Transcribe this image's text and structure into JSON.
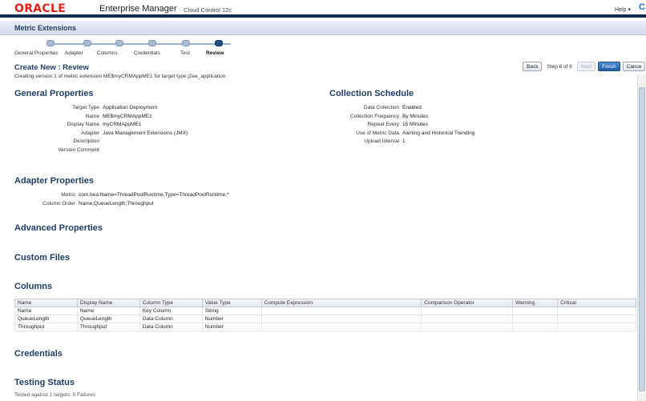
{
  "header": {
    "brand": "ORACLE",
    "product": "Enterprise Manager",
    "subtitle": "Cloud Control 12c",
    "help": "Help ▾",
    "right_icon": "C"
  },
  "band": {
    "title": "Metric Extensions"
  },
  "train": [
    {
      "label": "General Properties",
      "active": false
    },
    {
      "label": "Adapter",
      "active": false
    },
    {
      "label": "Columns",
      "active": false
    },
    {
      "label": "Credentials",
      "active": false
    },
    {
      "label": "Test",
      "active": false
    },
    {
      "label": "Review",
      "active": true
    }
  ],
  "page": {
    "title": "Create New : Review",
    "description": "Creating version 1 of metric extension ME$myCRMAppME1 for target type j2ee_application"
  },
  "nav": {
    "back": "Back",
    "step": "Step 6 of 6",
    "next": "Next",
    "finish": "Finish",
    "cancel": "Cance"
  },
  "general": {
    "heading": "General Properties",
    "rows": [
      {
        "label": "Target Type",
        "value": "Application Deployment"
      },
      {
        "label": "Name",
        "value": "ME$myCRMAppME1"
      },
      {
        "label": "Display Name",
        "value": "myCRMAppME1"
      },
      {
        "label": "Adapter",
        "value": "Java Management Extensions (JMX)"
      },
      {
        "label": "Description",
        "value": ""
      },
      {
        "label": "Version Comment",
        "value": ""
      }
    ]
  },
  "schedule": {
    "heading": "Collection Schedule",
    "rows": [
      {
        "label": "Data Collection",
        "value": "Enabled"
      },
      {
        "label": "Collection Frequency",
        "value": "By Minutes"
      },
      {
        "label": "Repeat Every",
        "value": "15      Minutes"
      },
      {
        "label": "Use of Metric Data",
        "value": "Alerting and Historical Trending"
      },
      {
        "label": "Upload Interval",
        "value": "1"
      }
    ]
  },
  "adapter": {
    "heading": "Adapter Properties",
    "rows": [
      {
        "label": "Metric",
        "value": "com.bea:Name=ThreadPoolRuntime,Type=ThreadPoolRuntime,*"
      },
      {
        "label": "Column Order",
        "value": "Name;QueueLength;Throughput"
      }
    ]
  },
  "advanced": {
    "heading": "Advanced Properties"
  },
  "custom_files": {
    "heading": "Custom Files"
  },
  "columns": {
    "heading": "Columns",
    "headers": [
      "Name",
      "Display Name",
      "Column Type",
      "Value Type",
      "Compute Expression",
      "Comparison Operator",
      "Warning",
      "Critical"
    ],
    "rows": [
      [
        "Name",
        "Name",
        "Key Column",
        "String",
        "",
        "",
        "",
        ""
      ],
      [
        "QueueLength",
        "QueueLength",
        "Data Column",
        "Number",
        "",
        "",
        "",
        ""
      ],
      [
        "Throughput",
        "Throughput",
        "Data Column",
        "Number",
        "",
        "",
        "",
        ""
      ]
    ]
  },
  "credentials": {
    "heading": "Credentials"
  },
  "testing": {
    "heading": "Testing Status",
    "text": "Tested against 1 targets: 0 Failures"
  },
  "colors": {
    "brand_red": "#e2231a",
    "header_navy": "#112b4d",
    "section_blue": "#1f3d66",
    "finish_blue": "#1f5fa8"
  }
}
